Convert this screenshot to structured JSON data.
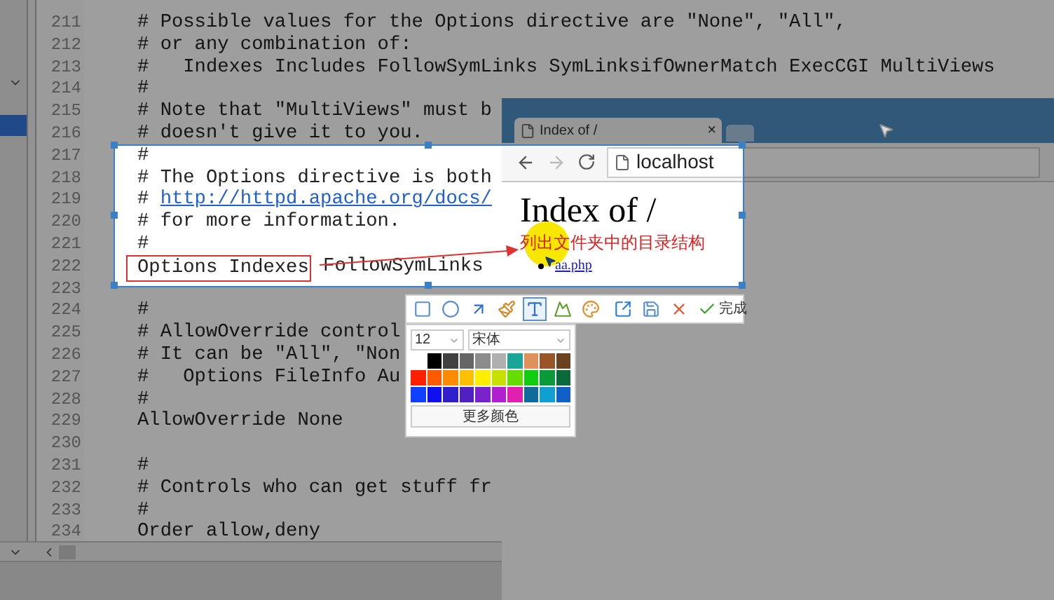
{
  "editor": {
    "lines": [
      {
        "number": "211",
        "text": "# Possible values for the Options directive are \"None\", \"All\","
      },
      {
        "number": "212",
        "text": "# or any combination of:"
      },
      {
        "number": "213",
        "text": "#   Indexes Includes FollowSymLinks SymLinksifOwnerMatch ExecCGI MultiViews"
      },
      {
        "number": "214",
        "text": "#"
      },
      {
        "number": "215",
        "text": "# Note that \"MultiViews\" must b"
      },
      {
        "number": "216",
        "text": "# doesn't give it to you."
      },
      {
        "number": "217",
        "text": "#"
      },
      {
        "number": "218",
        "text": "# The Options directive is both"
      },
      {
        "number": "219",
        "text": "# ",
        "link": "http://httpd.apache.org/docs/"
      },
      {
        "number": "220",
        "text": "# for more information."
      },
      {
        "number": "221",
        "text": "#"
      },
      {
        "number": "222",
        "boxed": "Options Indexes",
        "text": " FollowSymLinks"
      },
      {
        "number": "223"
      },
      {
        "number": "224",
        "text": "#"
      },
      {
        "number": "225",
        "text": "# AllowOverride control"
      },
      {
        "number": "226",
        "text": "# It can be \"All\", \"Non"
      },
      {
        "number": "227",
        "text": "#   Options FileInfo Au"
      },
      {
        "number": "228",
        "text": "#"
      },
      {
        "number": "229",
        "text": "AllowOverride None"
      },
      {
        "number": "230"
      },
      {
        "number": "231",
        "text": "#"
      },
      {
        "number": "232",
        "text": "# Controls who can get stuff fr"
      },
      {
        "number": "233",
        "text": "#"
      },
      {
        "number": "234",
        "text": "Order allow,deny"
      }
    ]
  },
  "browser": {
    "tab_title": "Index of /",
    "close": "×",
    "address": "localhost",
    "heading": "Index of /",
    "links": [
      "aa.php"
    ]
  },
  "annotation": {
    "text": "列出文件夹中的目录结构"
  },
  "capture_toolbar": {
    "tools": [
      {
        "kind": "rectangle",
        "selected": false
      },
      {
        "kind": "ellipse",
        "selected": false
      },
      {
        "kind": "arrow",
        "selected": false
      },
      {
        "kind": "brush",
        "selected": false
      },
      {
        "kind": "text",
        "selected": true
      },
      {
        "kind": "mosaic",
        "selected": false
      },
      {
        "kind": "palette",
        "selected": false
      },
      {
        "kind": "export",
        "selected": false
      },
      {
        "kind": "save",
        "selected": false
      },
      {
        "kind": "cancel",
        "selected": false
      },
      {
        "kind": "done",
        "selected": false,
        "label": "完成"
      }
    ]
  },
  "palette": {
    "font_size": "12",
    "font_name": "宋体",
    "more_label": "更多颜色",
    "colors": [
      {
        "color": "#000000"
      },
      {
        "color": "#404040"
      },
      {
        "color": "#666666"
      },
      {
        "color": "#8c8c8c"
      },
      {
        "color": "#b0b0b0"
      },
      {
        "color": "#1aa598"
      },
      {
        "color": "#e0905a"
      },
      {
        "color": "#99542a"
      },
      {
        "color": "#6a4220"
      },
      {
        "color": "#ff2000"
      },
      {
        "color": "#ff5a00"
      },
      {
        "color": "#ff8c00"
      },
      {
        "color": "#ffc000"
      },
      {
        "color": "#ffee00"
      },
      {
        "color": "#c8e000"
      },
      {
        "color": "#66dd00"
      },
      {
        "color": "#11cc11"
      },
      {
        "color": "#0a9a3a"
      },
      {
        "color": "#0a6a3a"
      },
      {
        "color": "#1040ff"
      },
      {
        "color": "#1010ee"
      },
      {
        "color": "#3020cc"
      },
      {
        "color": "#5020c0"
      },
      {
        "color": "#7a22cc"
      },
      {
        "color": "#b020d0"
      },
      {
        "color": "#e020b0"
      },
      {
        "color": "#106a9a"
      },
      {
        "color": "#10a0d0"
      },
      {
        "color": "#1060c8"
      }
    ]
  }
}
